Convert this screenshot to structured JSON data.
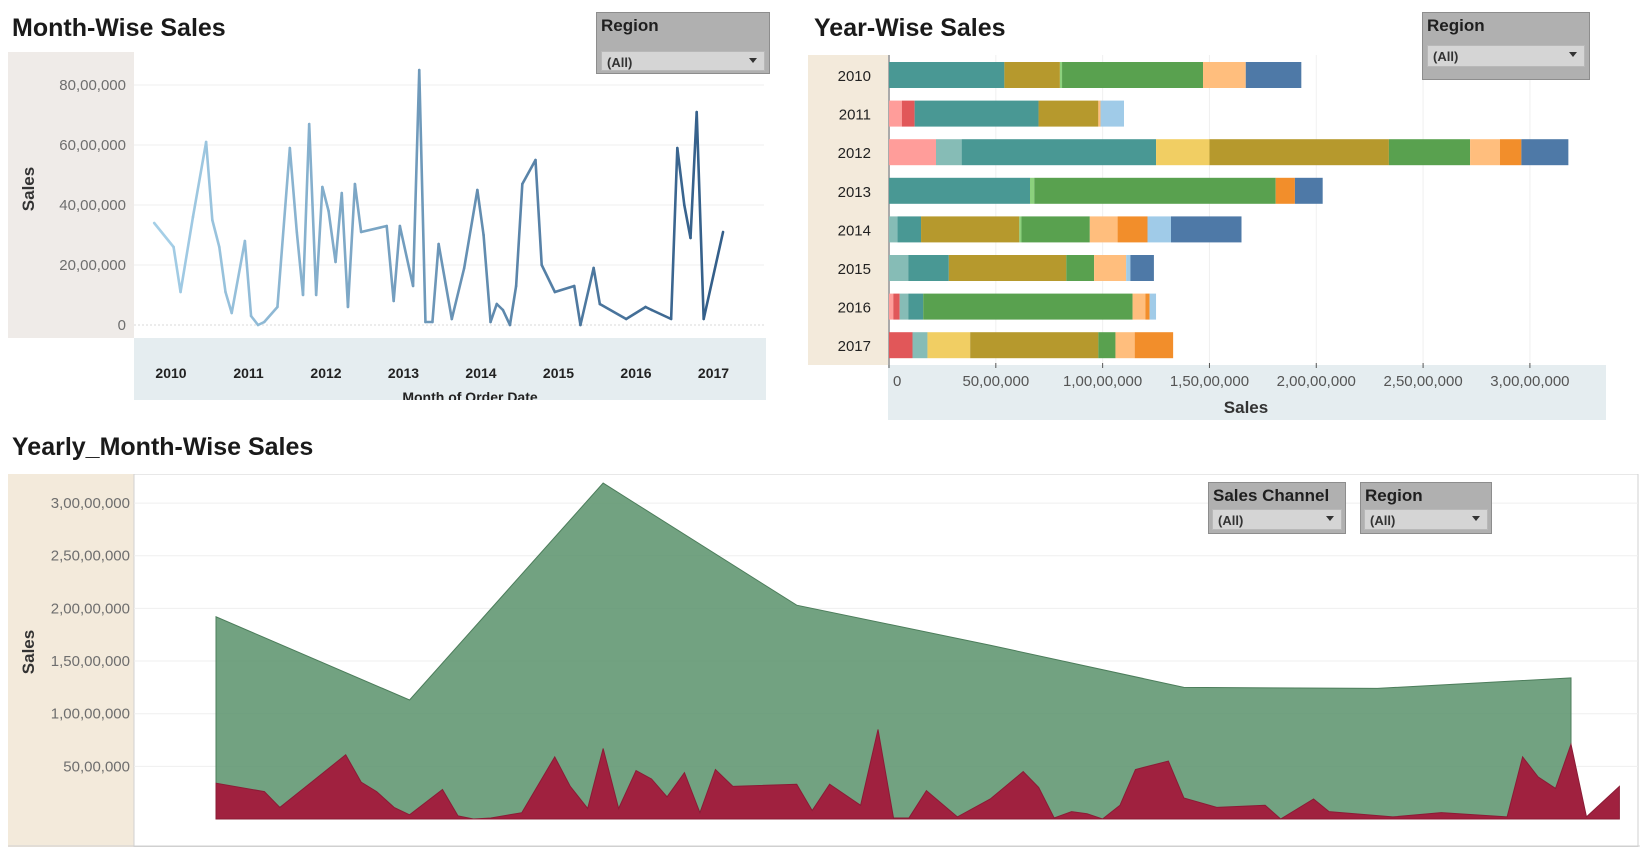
{
  "sheets": {
    "month": {
      "title": "Month-Wise Sales"
    },
    "year": {
      "title": "Year-Wise Sales"
    },
    "yearly_month": {
      "title": "Yearly_Month-Wise Sales"
    }
  },
  "filters": {
    "month_region": {
      "label": "Region",
      "value": "(All)"
    },
    "year_region": {
      "label": "Region",
      "value": "(All)"
    },
    "bottom_channel": {
      "label": "Sales Channel",
      "value": "(All)"
    },
    "bottom_region": {
      "label": "Region",
      "value": "(All)"
    }
  },
  "colors": {
    "line_light": "#a6d0e8",
    "line_dark": "#2f5a86",
    "area_total": "#5f9570",
    "area_monthly": "#a0213f",
    "axis_band_tan": "#f3eadb",
    "axis_band_blue": "#e5edf0",
    "axis_band_grey": "#efebe8"
  },
  "chart_data": [
    {
      "type": "line",
      "title": "Month-Wise Sales",
      "xlabel": "Month of Order Date",
      "ylabel": "Sales",
      "x_tick_labels": [
        "2010",
        "2011",
        "2012",
        "2013",
        "2014",
        "2015",
        "2016",
        "2017"
      ],
      "x_range": [
        2010,
        2018
      ],
      "ylim": [
        0,
        9000000
      ],
      "y_ticks": [
        0,
        2000000,
        4000000,
        6000000,
        8000000
      ],
      "y_tick_labels": [
        "0",
        "20,00,000",
        "40,00,000",
        "60,00,000",
        "80,00,000"
      ],
      "grid": true,
      "series": [
        {
          "values": [
            [
              2010.08,
              3400000
            ],
            [
              2010.33,
              2600000
            ],
            [
              2010.42,
              1100000
            ],
            [
              2010.58,
              3600000
            ],
            [
              2010.75,
              6100000
            ],
            [
              2010.83,
              3500000
            ],
            [
              2010.92,
              2600000
            ],
            [
              2011.0,
              1100000
            ],
            [
              2011.08,
              400000
            ],
            [
              2011.25,
              2800000
            ],
            [
              2011.33,
              300000
            ],
            [
              2011.42,
              0
            ],
            [
              2011.5,
              100000
            ],
            [
              2011.67,
              600000
            ],
            [
              2011.83,
              5900000
            ],
            [
              2011.92,
              3100000
            ],
            [
              2012.0,
              1000000
            ],
            [
              2012.08,
              6700000
            ],
            [
              2012.17,
              1000000
            ],
            [
              2012.25,
              4600000
            ],
            [
              2012.33,
              3800000
            ],
            [
              2012.42,
              2100000
            ],
            [
              2012.5,
              4400000
            ],
            [
              2012.58,
              600000
            ],
            [
              2012.67,
              4700000
            ],
            [
              2012.75,
              3100000
            ],
            [
              2013.08,
              3300000
            ],
            [
              2013.17,
              800000
            ],
            [
              2013.25,
              3300000
            ],
            [
              2013.42,
              1300000
            ],
            [
              2013.5,
              8500000
            ],
            [
              2013.58,
              100000
            ],
            [
              2013.67,
              100000
            ],
            [
              2013.75,
              2700000
            ],
            [
              2013.92,
              200000
            ],
            [
              2014.08,
              1900000
            ],
            [
              2014.25,
              4500000
            ],
            [
              2014.33,
              3000000
            ],
            [
              2014.42,
              100000
            ],
            [
              2014.5,
              700000
            ],
            [
              2014.58,
              500000
            ],
            [
              2014.67,
              0
            ],
            [
              2014.75,
              1300000
            ],
            [
              2014.83,
              4700000
            ],
            [
              2015.0,
              5500000
            ],
            [
              2015.08,
              2000000
            ],
            [
              2015.25,
              1100000
            ],
            [
              2015.5,
              1300000
            ],
            [
              2015.58,
              0
            ],
            [
              2015.75,
              1900000
            ],
            [
              2015.83,
              700000
            ],
            [
              2016.17,
              200000
            ],
            [
              2016.42,
              600000
            ],
            [
              2016.5,
              500000
            ],
            [
              2016.75,
              200000
            ],
            [
              2016.83,
              5900000
            ],
            [
              2016.92,
              4000000
            ],
            [
              2017.0,
              2900000
            ],
            [
              2017.08,
              7100000
            ],
            [
              2017.17,
              200000
            ],
            [
              2017.42,
              3100000
            ]
          ]
        }
      ]
    },
    {
      "type": "bar",
      "orientation": "horizontal",
      "stacked": true,
      "title": "Year-Wise Sales",
      "xlabel": "Sales",
      "categories": [
        "2010",
        "2011",
        "2012",
        "2013",
        "2014",
        "2015",
        "2016",
        "2017"
      ],
      "xlim": [
        0,
        33000000
      ],
      "x_ticks": [
        0,
        5000000,
        10000000,
        15000000,
        20000000,
        25000000,
        30000000
      ],
      "x_tick_labels": [
        "0",
        "50,00,000",
        "1,00,00,000",
        "1,50,00,000",
        "2,00,00,000",
        "2,50,00,000",
        "3,00,00,000"
      ],
      "grid": true,
      "segment_colors": [
        "#ff9d9a",
        "#e15759",
        "#86bcb6",
        "#499894",
        "#f1ce63",
        "#b6992d",
        "#8cd17d",
        "#59a14f",
        "#ffbe7d",
        "#f28e2b",
        "#a0cbe8",
        "#4e79a7"
      ],
      "rows": [
        [
          0,
          0,
          0,
          5400000,
          0,
          2600000,
          100000,
          6600000,
          2000000,
          0,
          0,
          2600000
        ],
        [
          600000,
          600000,
          0,
          5800000,
          0,
          2800000,
          0,
          0,
          100000,
          0,
          1100000,
          0
        ],
        [
          2200000,
          0,
          1200000,
          9100000,
          2500000,
          8400000,
          0,
          3800000,
          1400000,
          1000000,
          0,
          2200000
        ],
        [
          0,
          0,
          0,
          6600000,
          0,
          0,
          200000,
          11300000,
          0,
          900000,
          0,
          1300000
        ],
        [
          0,
          0,
          400000,
          1100000,
          0,
          4600000,
          100000,
          3200000,
          1300000,
          1400000,
          1100000,
          3300000
        ],
        [
          0,
          0,
          900000,
          1900000,
          0,
          5500000,
          0,
          1300000,
          1500000,
          0,
          200000,
          1100000
        ],
        [
          200000,
          300000,
          400000,
          700000,
          0,
          0,
          0,
          9800000,
          600000,
          200000,
          300000,
          0
        ],
        [
          0,
          1100000,
          700000,
          0,
          2000000,
          6000000,
          0,
          800000,
          900000,
          1800000,
          0,
          0
        ]
      ]
    },
    {
      "type": "area",
      "title": "Yearly_Month-Wise Sales",
      "ylabel": "Sales",
      "ylim": [
        0,
        32000000
      ],
      "y_ticks": [
        5000000,
        10000000,
        15000000,
        20000000,
        25000000,
        30000000
      ],
      "y_tick_labels": [
        "50,00,000",
        "1,00,00,000",
        "1,50,00,000",
        "2,00,00,000",
        "2,50,00,000",
        "3,00,00,000"
      ],
      "grid": true,
      "x_range": [
        2010,
        2018
      ],
      "series": [
        {
          "values": [
            [
              2010,
              19200000
            ],
            [
              2011,
              11300000
            ],
            [
              2012,
              31900000
            ],
            [
              2013,
              20300000
            ],
            [
              2014,
              16500000
            ],
            [
              2015,
              12500000
            ],
            [
              2016,
              12400000
            ],
            [
              2017,
              13400000
            ]
          ]
        },
        {
          "values": [
            [
              2010.0,
              3400000
            ],
            [
              2010.25,
              2600000
            ],
            [
              2010.33,
              1100000
            ],
            [
              2010.5,
              3600000
            ],
            [
              2010.67,
              6100000
            ],
            [
              2010.75,
              3500000
            ],
            [
              2010.83,
              2600000
            ],
            [
              2010.92,
              1100000
            ],
            [
              2011.0,
              400000
            ],
            [
              2011.17,
              2800000
            ],
            [
              2011.25,
              300000
            ],
            [
              2011.33,
              0
            ],
            [
              2011.42,
              100000
            ],
            [
              2011.58,
              600000
            ],
            [
              2011.75,
              5900000
            ],
            [
              2011.83,
              3100000
            ],
            [
              2011.92,
              1000000
            ],
            [
              2012.0,
              6700000
            ],
            [
              2012.08,
              1000000
            ],
            [
              2012.17,
              4600000
            ],
            [
              2012.25,
              3800000
            ],
            [
              2012.33,
              2100000
            ],
            [
              2012.42,
              4400000
            ],
            [
              2012.5,
              600000
            ],
            [
              2012.58,
              4700000
            ],
            [
              2012.67,
              3100000
            ],
            [
              2013.0,
              3300000
            ],
            [
              2013.08,
              800000
            ],
            [
              2013.17,
              3300000
            ],
            [
              2013.33,
              1300000
            ],
            [
              2013.42,
              8500000
            ],
            [
              2013.5,
              100000
            ],
            [
              2013.58,
              100000
            ],
            [
              2013.67,
              2700000
            ],
            [
              2013.83,
              200000
            ],
            [
              2014.0,
              1900000
            ],
            [
              2014.17,
              4500000
            ],
            [
              2014.25,
              3000000
            ],
            [
              2014.33,
              100000
            ],
            [
              2014.42,
              700000
            ],
            [
              2014.5,
              500000
            ],
            [
              2014.58,
              0
            ],
            [
              2014.67,
              1300000
            ],
            [
              2014.75,
              4700000
            ],
            [
              2014.92,
              5500000
            ],
            [
              2015.0,
              2000000
            ],
            [
              2015.17,
              1100000
            ],
            [
              2015.42,
              1300000
            ],
            [
              2015.5,
              0
            ],
            [
              2015.67,
              1900000
            ],
            [
              2015.75,
              700000
            ],
            [
              2016.08,
              200000
            ],
            [
              2016.33,
              600000
            ],
            [
              2016.42,
              500000
            ],
            [
              2016.67,
              200000
            ],
            [
              2016.75,
              5900000
            ],
            [
              2016.83,
              4000000
            ],
            [
              2016.92,
              2900000
            ],
            [
              2017.0,
              7100000
            ],
            [
              2017.08,
              200000
            ],
            [
              2017.25,
              3100000
            ]
          ]
        }
      ]
    }
  ]
}
